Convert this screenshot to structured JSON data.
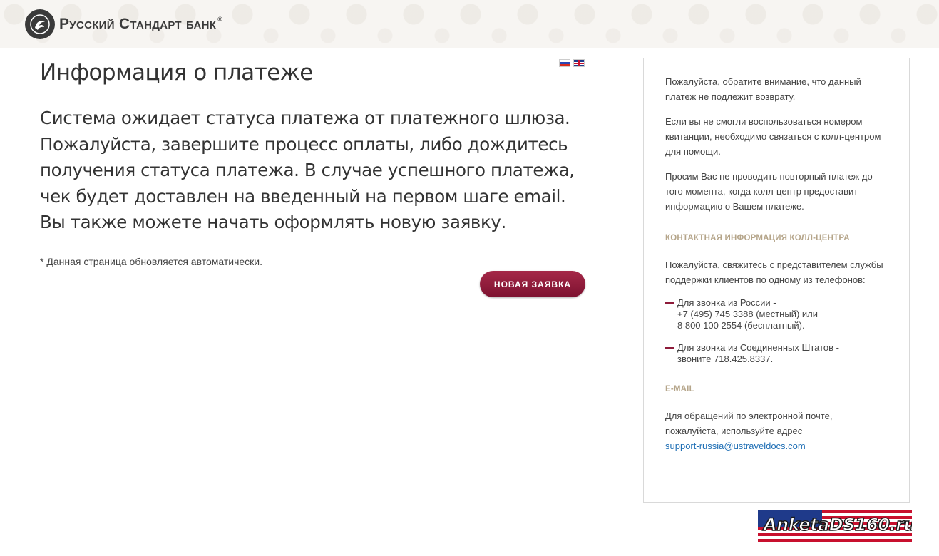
{
  "header": {
    "logo_text": "Русский Стандарт банк",
    "logo_registered_mark": "®",
    "logo_icon": "bank-emblem-icon"
  },
  "languages": [
    {
      "code": "ru",
      "icon": "flag-ru-icon"
    },
    {
      "code": "en",
      "icon": "flag-uk-icon"
    }
  ],
  "main": {
    "title": "Информация о платеже",
    "message": "Система ожидает статуса платежа от платежного шлюза. Пожалуйста, завершите процесс оплаты, либо дождитесь получения статуса платежа. В случае успешного платежа, чек будет доставлен на введенный на первом шаге email. Вы также можете начать оформлять новую заявку.",
    "auto_refresh_note": "* Данная страница обновляется автоматически.",
    "new_request_button": "НОВАЯ ЗАЯВКА"
  },
  "sidebar": {
    "notice_1": "Пожалуйста, обратите внимание, что данный платеж не подлежит возврату.",
    "notice_2": "Если вы не смогли воспользоваться номером квитанции, необходимо связаться с колл-центром для помощи.",
    "notice_3": "Просим Вас не проводить повторный платеж до того момента, когда колл-центр предоставит информацию о Вашем платеже.",
    "contact_heading": "КОНТАКТНАЯ ИНФОРМАЦИЯ КОЛЛ-ЦЕНТРА",
    "contact_intro": "Пожалуйста, свяжитесь с представителем службы поддержки клиентов по одному из телефонов:",
    "phones": [
      {
        "line1": "Для звонка из России -",
        "line2": "+7 (495) 745 3388 (местный) или",
        "line3": "8 800 100 2554 (бесплатный)."
      },
      {
        "line1": "Для звонка из Соединенных Штатов -",
        "line2": "звоните 718.425.8337."
      }
    ],
    "email_heading": "E-MAIL",
    "email_intro": "Для обращений по электронной почте, пожалуйста, используйте адрес",
    "email_address": "support-russia@ustraveldocs.com"
  },
  "watermark": {
    "text": "AnketaDS160.ru"
  },
  "colors": {
    "accent": "#8e1b3a",
    "heading_gold": "#b5a58a",
    "link": "#1f6fb5",
    "text": "#333333"
  }
}
